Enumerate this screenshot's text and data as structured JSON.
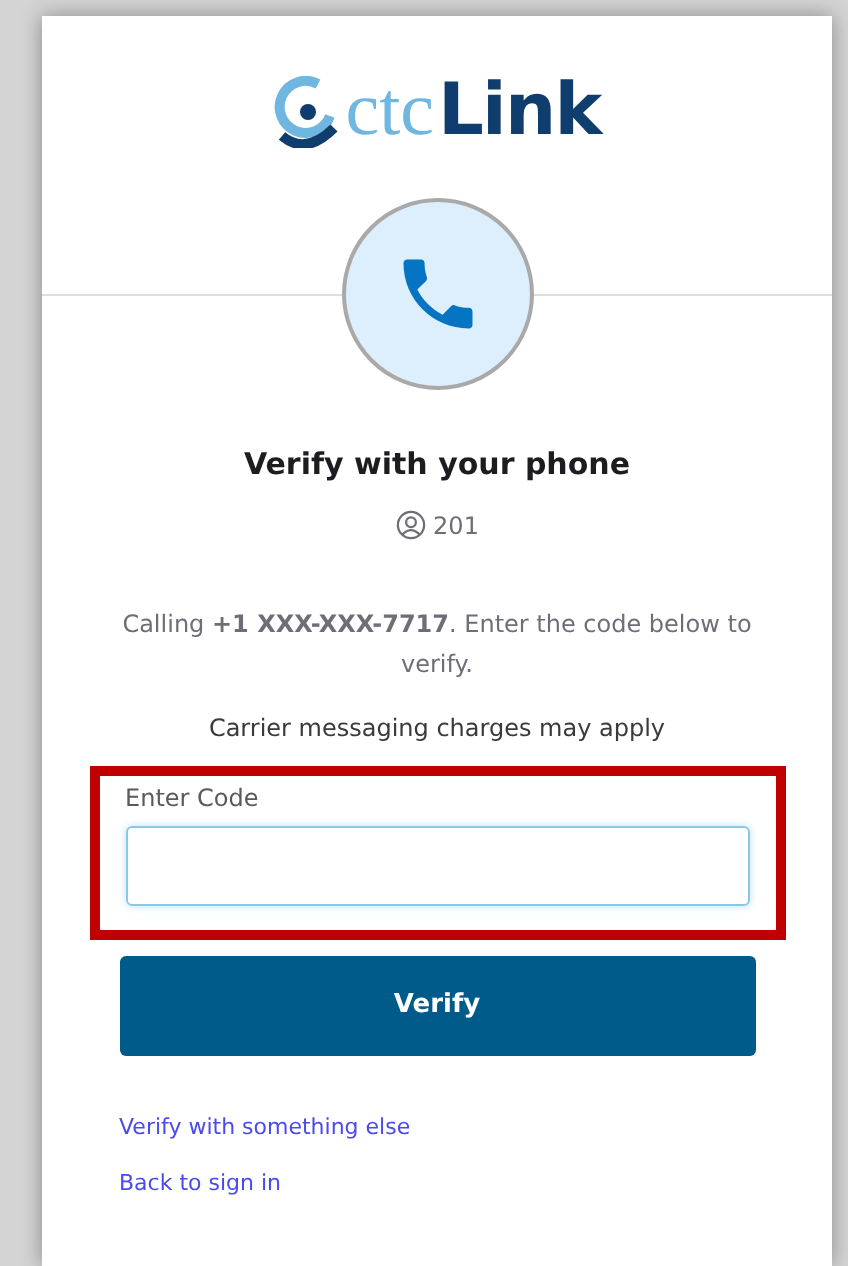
{
  "logo": {
    "part_1": "ctc",
    "part_2": "Link"
  },
  "title": "Verify with your phone",
  "user": "201",
  "instructions": "Calling **+1 XXX-XXX-7717**.  Enter the code below to verify.",
  "notice": "Carrier messaging charges may apply",
  "code_field": {
    "label": "Enter Code",
    "highlighted": true
  },
  "verify_button": "Verify",
  "links": [
    "Verify with something else",
    "Back to sign in"
  ]
}
